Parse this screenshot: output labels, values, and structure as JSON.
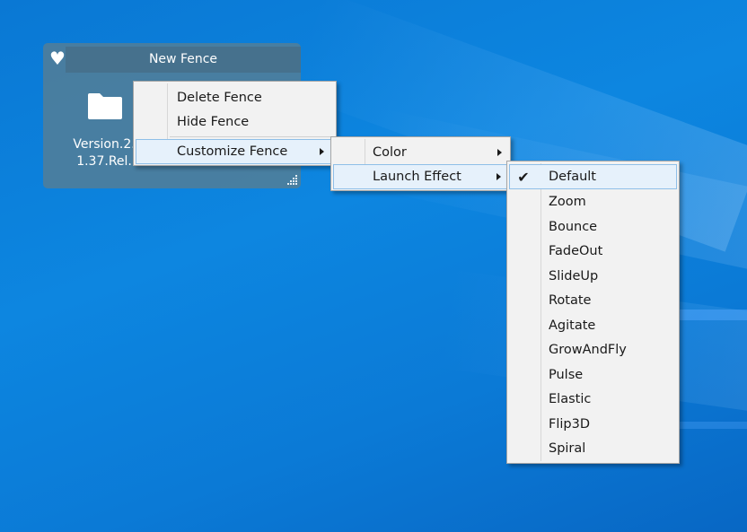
{
  "fence": {
    "title": "New Fence",
    "heart_icon": "heart-icon",
    "item": {
      "icon": "folder-icon",
      "label_line1": "Version.2.5",
      "label_line2": "1.37.Rel..."
    }
  },
  "context_menu": {
    "items": [
      {
        "label": "Delete Fence"
      },
      {
        "label": "Hide Fence"
      },
      {
        "label": "Customize Fence",
        "submenu": true
      }
    ]
  },
  "customize_submenu": {
    "items": [
      {
        "label": "Color",
        "submenu": true
      },
      {
        "label": "Launch Effect",
        "submenu": true
      }
    ]
  },
  "launch_effect_submenu": {
    "selected": "Default",
    "items": [
      {
        "label": "Default"
      },
      {
        "label": "Zoom"
      },
      {
        "label": "Bounce"
      },
      {
        "label": "FadeOut"
      },
      {
        "label": "SlideUp"
      },
      {
        "label": "Rotate"
      },
      {
        "label": "Agitate"
      },
      {
        "label": "GrowAndFly"
      },
      {
        "label": "Pulse"
      },
      {
        "label": "Elastic"
      },
      {
        "label": "Flip3D"
      },
      {
        "label": "Spiral"
      }
    ]
  },
  "colors": {
    "desktop": "#0a78d4",
    "fence_bg": "#547e96",
    "menu_bg": "#f2f2f2",
    "highlight_bg": "#e6f1fb",
    "highlight_border": "#8fbfe8"
  }
}
